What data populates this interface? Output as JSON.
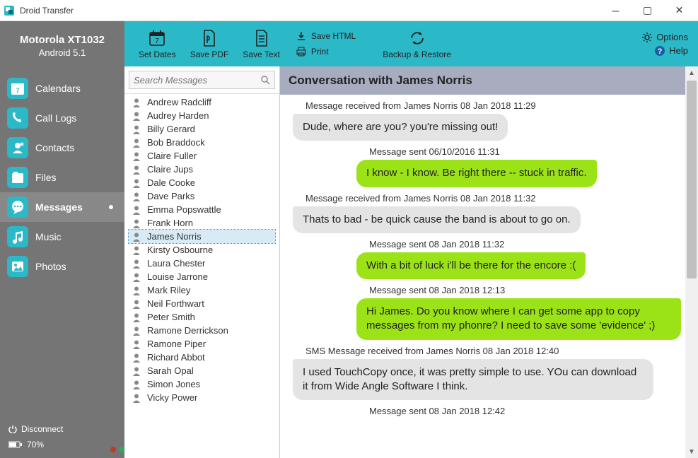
{
  "window": {
    "title": "Droid Transfer"
  },
  "device": {
    "name": "Motorola XT1032",
    "os": "Android 5.1"
  },
  "nav": {
    "items": [
      {
        "label": "Calendars",
        "icon": "calendar"
      },
      {
        "label": "Call Logs",
        "icon": "phone"
      },
      {
        "label": "Contacts",
        "icon": "contacts"
      },
      {
        "label": "Files",
        "icon": "files"
      },
      {
        "label": "Messages",
        "icon": "messages",
        "active": true
      },
      {
        "label": "Music",
        "icon": "music"
      },
      {
        "label": "Photos",
        "icon": "photos"
      }
    ]
  },
  "footer": {
    "disconnect": "Disconnect",
    "battery_pct": "70%"
  },
  "toolbar": {
    "set_dates": "Set Dates",
    "save_pdf": "Save PDF",
    "save_text": "Save Text",
    "save_html": "Save HTML",
    "print": "Print",
    "backup_restore": "Backup & Restore",
    "options": "Options",
    "help": "Help"
  },
  "search": {
    "placeholder": "Search Messages"
  },
  "contacts": [
    "Andrew Radcliff",
    "Audrey Harden",
    "Billy Gerard",
    "Bob Braddock",
    "Claire Fuller",
    "Claire Jups",
    "Dale Cooke",
    "Dave Parks",
    "Emma Popswattle",
    "Frank Horn",
    "James Norris",
    "Kirsty Osbourne",
    "Laura Chester",
    "Louise Jarrone",
    "Mark Riley",
    "Neil Forthwart",
    "Peter Smith",
    "Ramone Derrickson",
    "Ramone Piper",
    "Richard Abbot",
    "Sarah Opal",
    "Simon Jones",
    "Vicky Power"
  ],
  "contacts_selected_index": 10,
  "chat": {
    "title": "Conversation with James Norris",
    "messages": [
      {
        "dir": "received",
        "meta": "Message received from James Norris 08 Jan 2018 11:29",
        "text": "Dude, where are you? you're missing out!"
      },
      {
        "dir": "sent",
        "meta": "Message sent 06/10/2016 11:31",
        "text": "I know - I know. Be right there -- stuck in traffic."
      },
      {
        "dir": "received",
        "meta": "Message received from James Norris 08 Jan 2018 11:32",
        "text": "Thats to bad - be quick cause the band is about to go on."
      },
      {
        "dir": "sent",
        "meta": "Message sent 08 Jan 2018 11:32",
        "text": "With a bit of luck i'll be there for the encore :("
      },
      {
        "dir": "sent",
        "meta": "Message sent 08 Jan 2018 12:13",
        "text": "Hi James. Do you know where I can get some app to copy messages from my phonre? I need to save some 'evidence' ;)"
      },
      {
        "dir": "received",
        "meta": "SMS Message received from James Norris 08 Jan 2018 12:40",
        "text": "I used TouchCopy once, it was pretty simple to use. YOu can download it from Wide Angle Software I think."
      },
      {
        "dir": "sent",
        "meta": "Message sent 08 Jan 2018 12:42",
        "text": ""
      }
    ]
  },
  "colors": {
    "accent": "#2bb8c7",
    "sent_bubble": "#9be317",
    "recv_bubble": "#e4e4e4"
  }
}
